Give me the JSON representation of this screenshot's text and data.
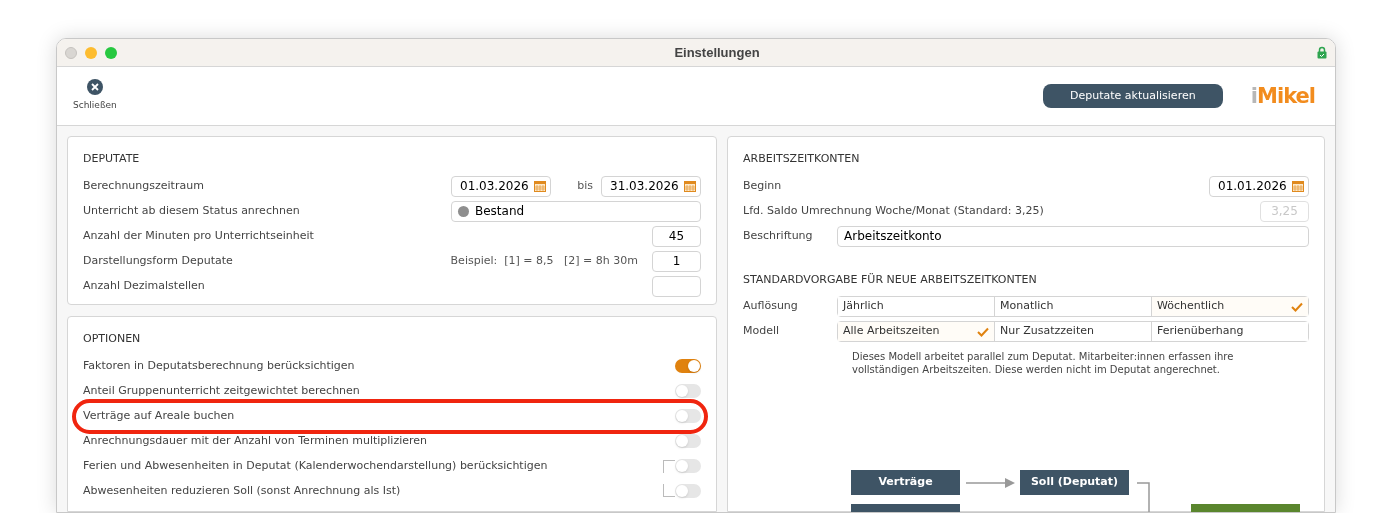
{
  "window": {
    "title": "Einstellungen"
  },
  "toolbar": {
    "close_label": "Schließen",
    "update_button": "Deputate aktualisieren",
    "logo": {
      "prefix": "i",
      "name": "Mikel"
    }
  },
  "deputate": {
    "title": "DEPUTATE",
    "rows": [
      {
        "kind": "daterange",
        "label": "Berechnungszeitraum",
        "from": "01.03.2026",
        "separator": "bis",
        "to": "31.03.2026"
      },
      {
        "kind": "status",
        "label": "Unterricht ab diesem Status anrechnen",
        "value": "Bestand",
        "color": "#8e8e8e"
      },
      {
        "kind": "number",
        "label": "Anzahl der Minuten pro Unterrichtseinheit",
        "value": "45"
      },
      {
        "kind": "number",
        "label": "Darstellungsform Deputate",
        "example": "Beispiel:  [1] = 8,5   [2] = 8h 30m",
        "value": "1"
      },
      {
        "kind": "number",
        "label": "Anzahl Dezimalstellen"
      }
    ]
  },
  "options": {
    "title": "OPTIONEN",
    "toggles": [
      {
        "label": "Faktoren in Deputatsberechnung berücksichtigen",
        "on": true,
        "highlighted": false,
        "grouped": false
      },
      {
        "label": "Anteil Gruppenunterricht zeitgewichtet berechnen",
        "on": false,
        "highlighted": false,
        "grouped": false
      },
      {
        "label": "Verträge auf Areale buchen",
        "on": false,
        "highlighted": true,
        "grouped": false
      },
      {
        "label": "Anrechnungsdauer mit der Anzahl von Terminen multiplizieren",
        "on": false,
        "highlighted": false,
        "grouped": false
      },
      {
        "label": "Ferien und Abwesenheiten in Deputat (Kalenderwochendarstellung) berücksichtigen",
        "on": false,
        "highlighted": false,
        "grouped": true
      },
      {
        "label": "Abwesenheiten reduzieren Soll (sonst Anrechnung als Ist)",
        "on": false,
        "highlighted": false,
        "grouped": true
      }
    ]
  },
  "arbeitszeitkonten": {
    "title": "ARBEITSZEITKONTEN",
    "beginn_label": "Beginn",
    "beginn": "01.01.2026",
    "saldo_label": "Lfd. Saldo Umrechnung Woche/Monat (Standard: 3,25)",
    "saldo_placeholder": "3,25",
    "beschriftung_label": "Beschriftung",
    "beschriftung": "Arbeitszeitkonto"
  },
  "standardvorgabe": {
    "title": "STANDARDVORGABE FÜR NEUE ARBEITSZEITKONTEN",
    "groups": [
      {
        "label": "Auflösung",
        "options": [
          {
            "label": "Jährlich",
            "selected": false
          },
          {
            "label": "Monatlich",
            "selected": false
          },
          {
            "label": "Wöchentlich",
            "selected": true
          }
        ]
      },
      {
        "label": "Modell",
        "options": [
          {
            "label": "Alle Arbeitszeiten",
            "selected": true
          },
          {
            "label": "Nur Zusatzzeiten",
            "selected": false
          },
          {
            "label": "Ferienüberhang",
            "selected": false
          }
        ]
      }
    ],
    "description": "Dieses Modell arbeitet parallel zum Deputat. Mitarbeiter:innen erfassen ihre vollständigen Arbeitszeiten. Diese werden nicht im Deputat angerechnet."
  },
  "diagram": {
    "nodes": [
      {
        "kind": "dark",
        "label": "Verträge"
      },
      {
        "kind": "dark",
        "label": "Soll (Deputat)"
      },
      {
        "kind": "dark"
      },
      {
        "kind": "green"
      }
    ]
  }
}
